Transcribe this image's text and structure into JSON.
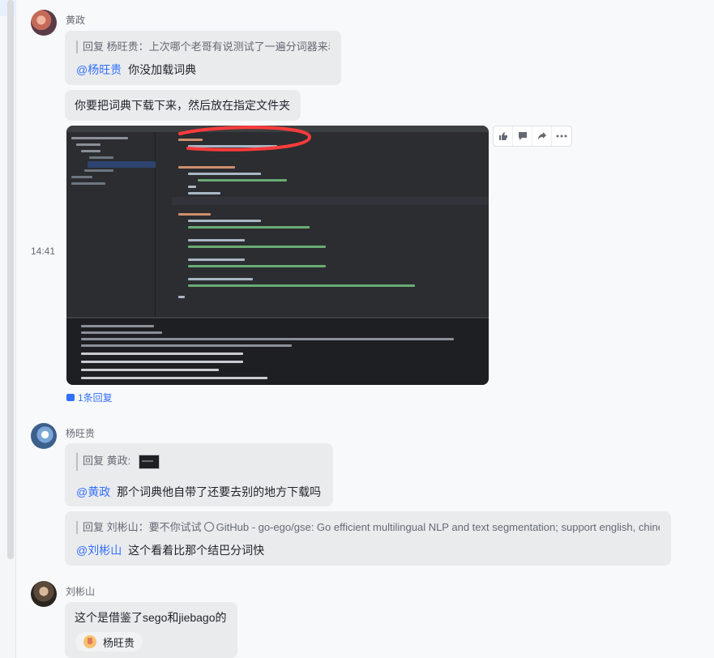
{
  "messages": [
    {
      "sender": "黄政",
      "quote": "回复 杨旺贵：上次哪个老哥有说测试了一遍分词器来着?",
      "mention": "@杨旺贵",
      "text": "你没加载词典",
      "followup": "你要把词典下载下来，然后放在指定文件夹",
      "timestamp": "14:41",
      "reply_count": "1条回复"
    },
    {
      "sender": "杨旺贵",
      "quote": "回复 黄政:",
      "mention": "@黄政",
      "text": "那个词典他自带了还要去别的地方下载吗",
      "quote2_prefix": "回复 刘彬山：要不你试试",
      "quote2_link": "GitHub - go-ego/gse: Go efficient multilingual NLP and text segmentation; support english, chinese, 这个",
      "mention2": "@刘彬山",
      "text2": "这个看着比那个结巴分词快"
    },
    {
      "sender": "刘彬山",
      "text": "这个是借鉴了sego和jiebago的",
      "reaction_user": "杨旺贵"
    }
  ],
  "icons": {
    "like": "thumbs-up-icon",
    "comment": "comment-icon",
    "forward": "forward-icon",
    "more": "more-icon",
    "link": "link-icon",
    "reply": "reply-icon"
  },
  "colors": {
    "accent": "#3370ff",
    "bubble": "#eaebed",
    "annotation": "#ff3b3b"
  }
}
